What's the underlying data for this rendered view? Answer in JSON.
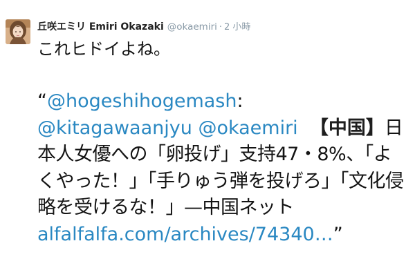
{
  "tweet": {
    "author": {
      "display_name": "丘咲エミリ Emiri Okazaki",
      "handle": "@okaemiri",
      "separator": "·",
      "time": "2 小時",
      "avatar": "avatar-photo"
    },
    "comment": "これヒドイよね。",
    "quote_open": "“",
    "mention_1": "@hogeshihogemash",
    "colon": ":",
    "mention_2": "@kitagawaanjyu",
    "mention_3": "@okaemiri",
    "tag": "【中国】",
    "text_1": "日本人女優への「卵投げ」支持47・8%、「よくやった！」「手りゅう弾を投げろ」「文化侵略を受けるな！」—中国ネット",
    "link": "alfalfalfa.com/archives/74340…",
    "quote_close": "”",
    "colors": {
      "link": "#2a88c2",
      "meta": "#8899a6",
      "text": "#141414"
    }
  }
}
